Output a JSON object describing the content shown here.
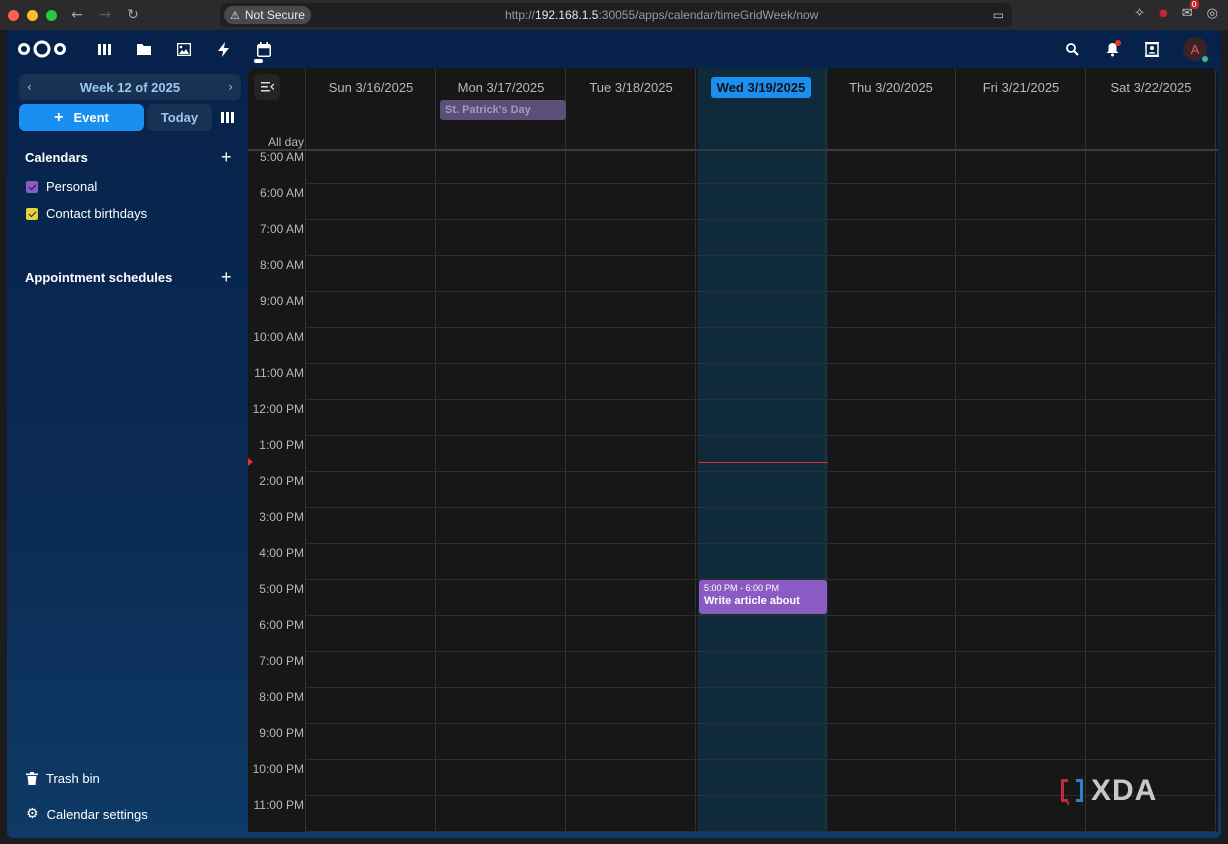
{
  "browser": {
    "security_label": "Not Secure",
    "url_prefix": "http://",
    "url_host": "192.168.1.5",
    "url_path": ":30055/apps/calendar/timeGridWeek/now",
    "traffic_colors": [
      "#ff5f57",
      "#febc2e",
      "#28c840"
    ],
    "ext_badge_count": "0"
  },
  "header": {
    "app_icons": [
      "dashboard-icon",
      "files-icon",
      "photos-icon",
      "activity-icon",
      "calendar-icon"
    ],
    "right_icons": [
      "search-icon",
      "notifications-icon",
      "contacts-icon"
    ],
    "avatar_initial": "A"
  },
  "sidebar": {
    "week_label": "Week 12 of 2025",
    "new_event_label": "Event",
    "today_label": "Today",
    "calendars_heading": "Calendars",
    "calendars": [
      {
        "name": "Personal",
        "color": "#8a5bc2"
      },
      {
        "name": "Contact birthdays",
        "color": "#e8d33f"
      }
    ],
    "appointments_heading": "Appointment schedules",
    "trash_label": "Trash bin",
    "settings_label": "Calendar settings"
  },
  "calendar": {
    "days": [
      "Sun 3/16/2025",
      "Mon 3/17/2025",
      "Tue 3/18/2025",
      "Wed 3/19/2025",
      "Thu 3/20/2025",
      "Fri 3/21/2025",
      "Sat 3/22/2025"
    ],
    "today_index": 3,
    "all_day_label": "All day",
    "hours": [
      "5:00 AM",
      "6:00 AM",
      "7:00 AM",
      "8:00 AM",
      "9:00 AM",
      "10:00 AM",
      "11:00 AM",
      "12:00 PM",
      "1:00 PM",
      "2:00 PM",
      "3:00 PM",
      "4:00 PM",
      "5:00 PM",
      "6:00 PM",
      "7:00 PM",
      "8:00 PM",
      "9:00 PM",
      "10:00 PM",
      "11:00 PM"
    ],
    "all_day_events": [
      {
        "title": "St. Patrick's Day",
        "day": "Mon 3/17/2025"
      }
    ],
    "events": [
      {
        "time": "5:00 PM - 6:00 PM",
        "title": "Write article about",
        "day": "Wed 3/19/2025"
      }
    ]
  },
  "watermark": {
    "text": "XDA"
  }
}
